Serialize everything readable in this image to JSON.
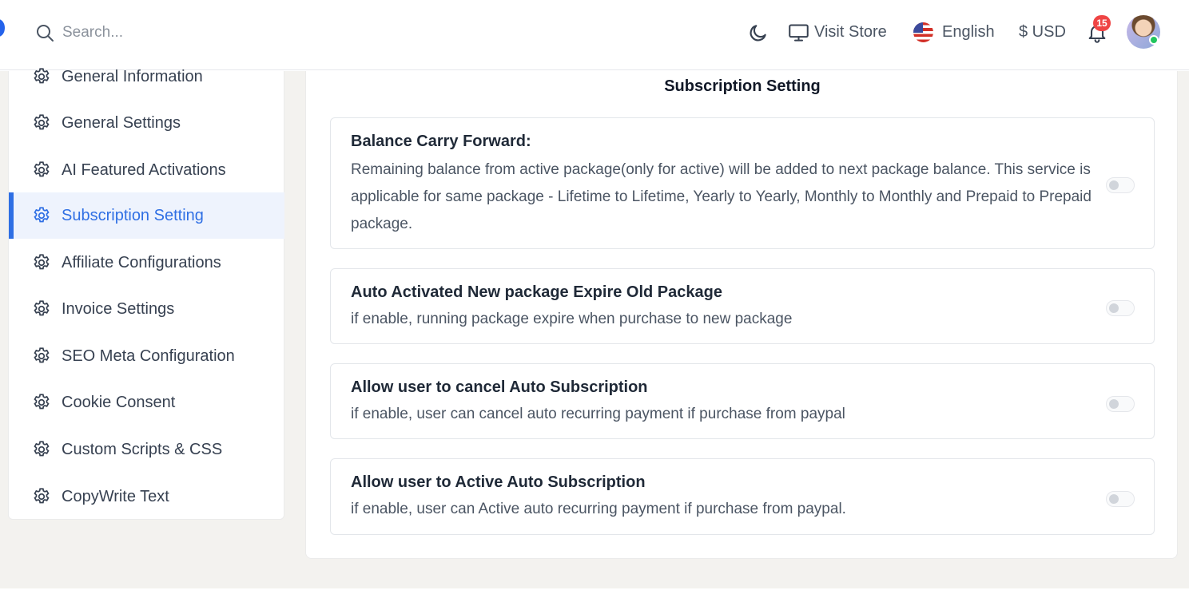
{
  "topbar": {
    "search_placeholder": "Search...",
    "visit_store": "Visit Store",
    "language": "English",
    "currency": "$ USD",
    "notification_count": "15"
  },
  "sidebar": {
    "items": [
      {
        "label": "General Information",
        "icon": "gear-icon"
      },
      {
        "label": "General Settings",
        "icon": "gear-icon"
      },
      {
        "label": "AI Featured Activations",
        "icon": "gear-icon"
      },
      {
        "label": "Subscription Setting",
        "icon": "gear-icon",
        "active": true
      },
      {
        "label": "Affiliate Configurations",
        "icon": "gear-icon"
      },
      {
        "label": "Invoice Settings",
        "icon": "gear-icon"
      },
      {
        "label": "SEO Meta Configuration",
        "icon": "gear-icon"
      },
      {
        "label": "Cookie Consent",
        "icon": "gear-icon"
      },
      {
        "label": "Custom Scripts & CSS",
        "icon": "gear-icon"
      },
      {
        "label": "CopyWrite Text",
        "icon": "gear-icon"
      }
    ]
  },
  "main": {
    "title": "Subscription Setting",
    "settings": [
      {
        "title": "Balance Carry Forward:",
        "description": "Remaining balance from active package(only for active) will be added to next package balance. This service is applicable for same package - Lifetime to Lifetime, Yearly to Yearly, Monthly to Monthly and Prepaid to Prepaid package.",
        "enabled": false
      },
      {
        "title": "Auto Activated New package Expire Old Package",
        "description": "if enable, running package expire when purchase to new package",
        "enabled": false
      },
      {
        "title": "Allow user to cancel Auto Subscription",
        "description": "if enable, user can cancel auto recurring payment if purchase from paypal",
        "enabled": false
      },
      {
        "title": "Allow user to Active Auto Subscription",
        "description": "if enable, user can Active auto recurring payment if purchase from paypal.",
        "enabled": false
      }
    ]
  },
  "colors": {
    "accent": "#2f6fe4",
    "active_bg": "#eef3fd",
    "badge": "#ef4444",
    "online": "#22c55e",
    "page_bg": "#f3f2ef"
  }
}
